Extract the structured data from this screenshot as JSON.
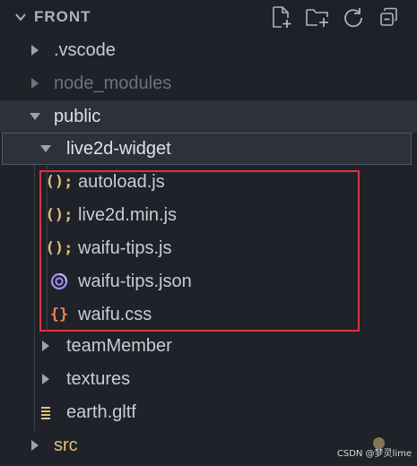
{
  "explorer": {
    "section_title": "FRONT",
    "actions": [
      {
        "name": "new-file-icon",
        "icon": "new-file"
      },
      {
        "name": "new-folder-icon",
        "icon": "new-folder"
      },
      {
        "name": "refresh-icon",
        "icon": "refresh"
      },
      {
        "name": "collapse-all-icon",
        "icon": "collapse-all"
      }
    ],
    "tree": {
      "vscode": ".vscode",
      "node_modules": "node_modules",
      "public": "public",
      "live2d_widget": "live2d-widget",
      "files": {
        "autoload": "autoload.js",
        "live2d_min": "live2d.min.js",
        "waifu_tips_js": "waifu-tips.js",
        "waifu_tips_json": "waifu-tips.json",
        "waifu_css": "waifu.css"
      },
      "teamMember": "teamMember",
      "textures": "textures",
      "earth": "earth.gltf",
      "src": "src"
    },
    "icon_glyphs": {
      "js": "();",
      "css": "{}",
      "json_icon": "json-icon",
      "gltf_icon": "lines-icon"
    }
  },
  "colors": {
    "background": "#1f2228",
    "text": "#c9ccd3",
    "muted_text": "#6b7280",
    "js_icon": "#e5c07b",
    "css_icon": "#f0824f",
    "json_icon": "#a78bfa",
    "gltf_icon": "#e5c07b",
    "src_label": "#e5c07b",
    "highlight": "#e0323a"
  },
  "watermark": "CSDN @梦灵lime"
}
